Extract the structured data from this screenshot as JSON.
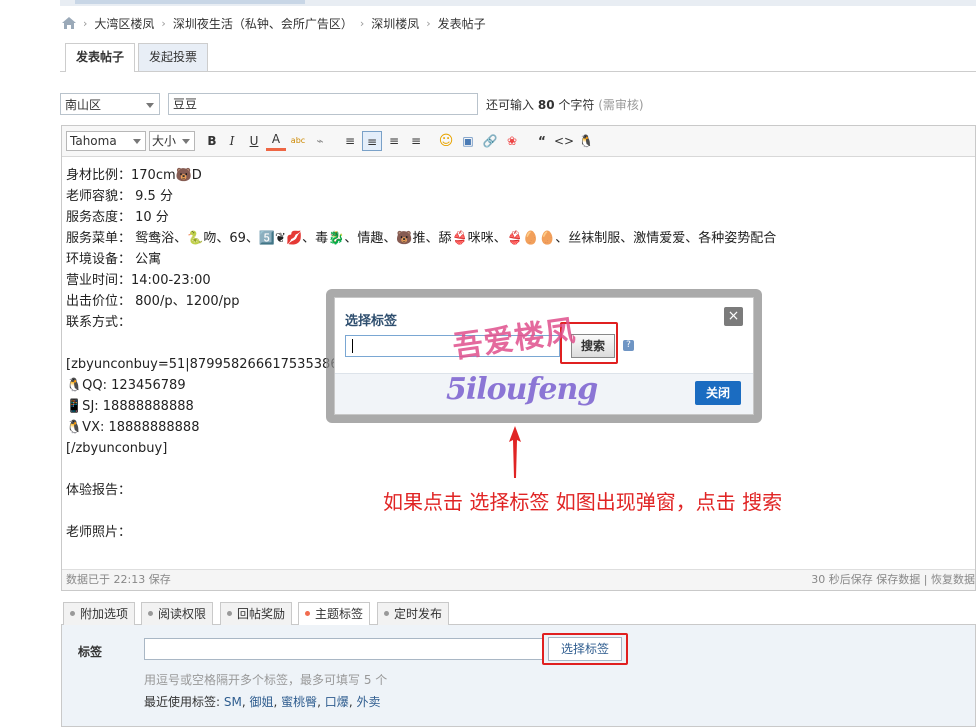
{
  "breadcrumb": {
    "items": [
      "大湾区楼凤",
      "深圳夜生活（私钟、会所广告区）",
      "深圳楼凤",
      "发表帖子"
    ],
    "sep": "›"
  },
  "tabs": [
    {
      "label": "发表帖子",
      "active": true
    },
    {
      "label": "发起投票",
      "active": false
    }
  ],
  "subject": {
    "category": "南山区",
    "title": "豆豆",
    "remain_prefix": "还可输入",
    "remain_count": "80",
    "remain_suffix": "个字符",
    "review_note": "(需审核)"
  },
  "toolbar": {
    "font": "Tahoma",
    "size": "大小",
    "buttons": [
      "B",
      "I",
      "U",
      "A",
      "abc",
      "⌁",
      "≡",
      "≡",
      "≡",
      "≡",
      "☺",
      "▣",
      "🔗",
      "❀",
      "“",
      "<>",
      "🐧"
    ]
  },
  "content": {
    "lines": [
      "身材比例：170cm🐻D",
      "老师容貌：  9.5 分",
      "服务态度：  10 分",
      "服务菜单：  鸳鸯浴、🐍吻、69、5️⃣❦💋、毒🐉、情趣、🐻推、舔👙咪咪、👙🥚🥚、丝袜制服、激情爱爱、各种姿势配合",
      "环境设备：  公寓",
      "营业时间：14:00-23:00",
      "出击价位：  800/p、1200/pp",
      "联系方式：",
      "",
      "[zbyunconbuy=51|87995826661753538696",
      "🐧QQ: 123456789",
      "📱SJ: 18888888888",
      "🐧VX: 18888888888",
      "[/zbyunconbuy]",
      "",
      "体验报告：",
      "",
      "老师照片："
    ]
  },
  "status": {
    "left": "数据已于 22:13 保存",
    "right": "30 秒后保存 保存数据 | 恢复数据"
  },
  "option_tabs": [
    {
      "label": "附加选项",
      "active": false
    },
    {
      "label": "阅读权限",
      "active": false
    },
    {
      "label": "回帖奖励",
      "active": false
    },
    {
      "label": "主题标签",
      "active": true
    },
    {
      "label": "定时发布",
      "active": false
    }
  ],
  "tag_panel": {
    "label": "标签",
    "input_value": "",
    "select_button": "选择标签",
    "hint": "用逗号或空格隔开多个标签，最多可填写 5 个",
    "recent_prefix": "最近使用标签: ",
    "recent": [
      "SM",
      "御姐",
      "蜜桃臀",
      "口爆",
      "外卖"
    ]
  },
  "dialog": {
    "title": "选择标签",
    "close_icon": "×",
    "search_value": "",
    "search_button": "搜索",
    "help": "?",
    "close_button": "关闭"
  },
  "watermark": {
    "line1": "吾爱楼凤",
    "line2": "5iloufeng"
  },
  "annotation": {
    "text": "如果点击 选择标签 如图出现弹窗，点击 搜索"
  },
  "colors": {
    "accent": "#1b6cc1",
    "annotation": "#e02424",
    "link": "#2f5d8f"
  }
}
